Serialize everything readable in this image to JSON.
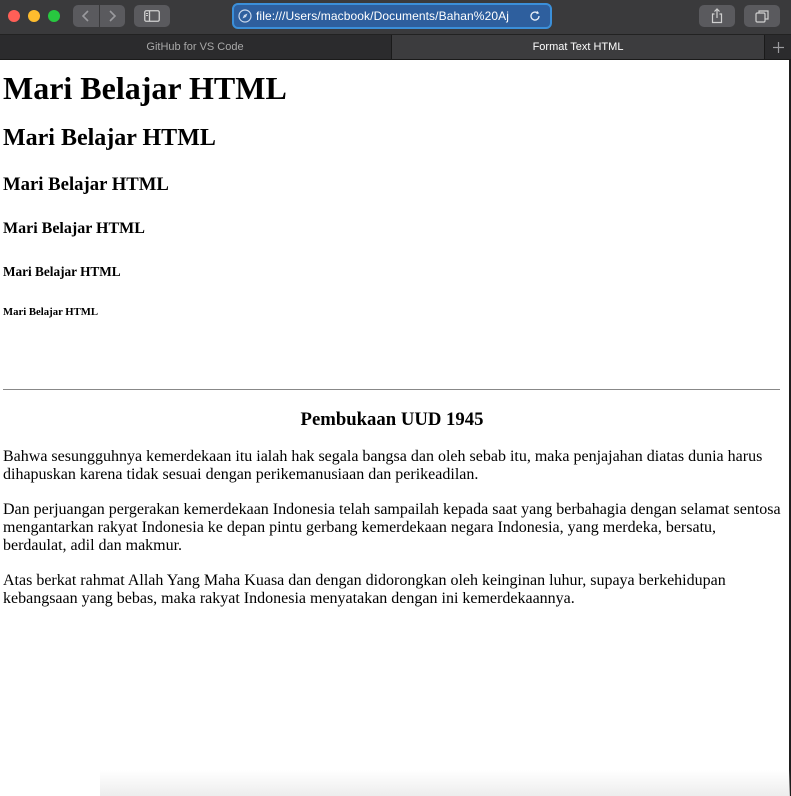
{
  "browser": {
    "url": "file:///Users/macbook/Documents/Bahan%20Aj",
    "tabs": [
      {
        "label": "GitHub for VS Code",
        "active": false
      },
      {
        "label": "Format Text HTML",
        "active": true
      }
    ],
    "colors": {
      "toolbar": "#3a3a3c",
      "url_focus": "#3b8fd9"
    }
  },
  "page": {
    "headings": [
      "Mari Belajar HTML",
      "Mari Belajar HTML",
      "Mari Belajar HTML",
      "Mari Belajar HTML",
      "Mari Belajar HTML",
      "Mari Belajar HTML"
    ],
    "section_title": "Pembukaan UUD 1945",
    "paragraphs": [
      "Bahwa sesungguhnya kemerdekaan itu ialah hak segala bangsa dan oleh sebab itu, maka penjajahan diatas dunia harus dihapuskan karena tidak sesuai dengan perikemanusiaan dan perikeadilan.",
      "Dan perjuangan pergerakan kemerdekaan Indonesia telah sampailah kepada saat yang berbahagia dengan selamat sentosa mengantarkan rakyat Indonesia ke depan pintu gerbang kemerdekaan negara Indonesia, yang merdeka, bersatu, berdaulat, adil dan makmur.",
      "Atas berkat rahmat Allah Yang Maha Kuasa dan dengan didorongkan oleh keinginan luhur, supaya berkehidupan kebangsaan yang bebas, maka rakyat Indonesia menyatakan dengan ini kemerdekaannya."
    ]
  }
}
